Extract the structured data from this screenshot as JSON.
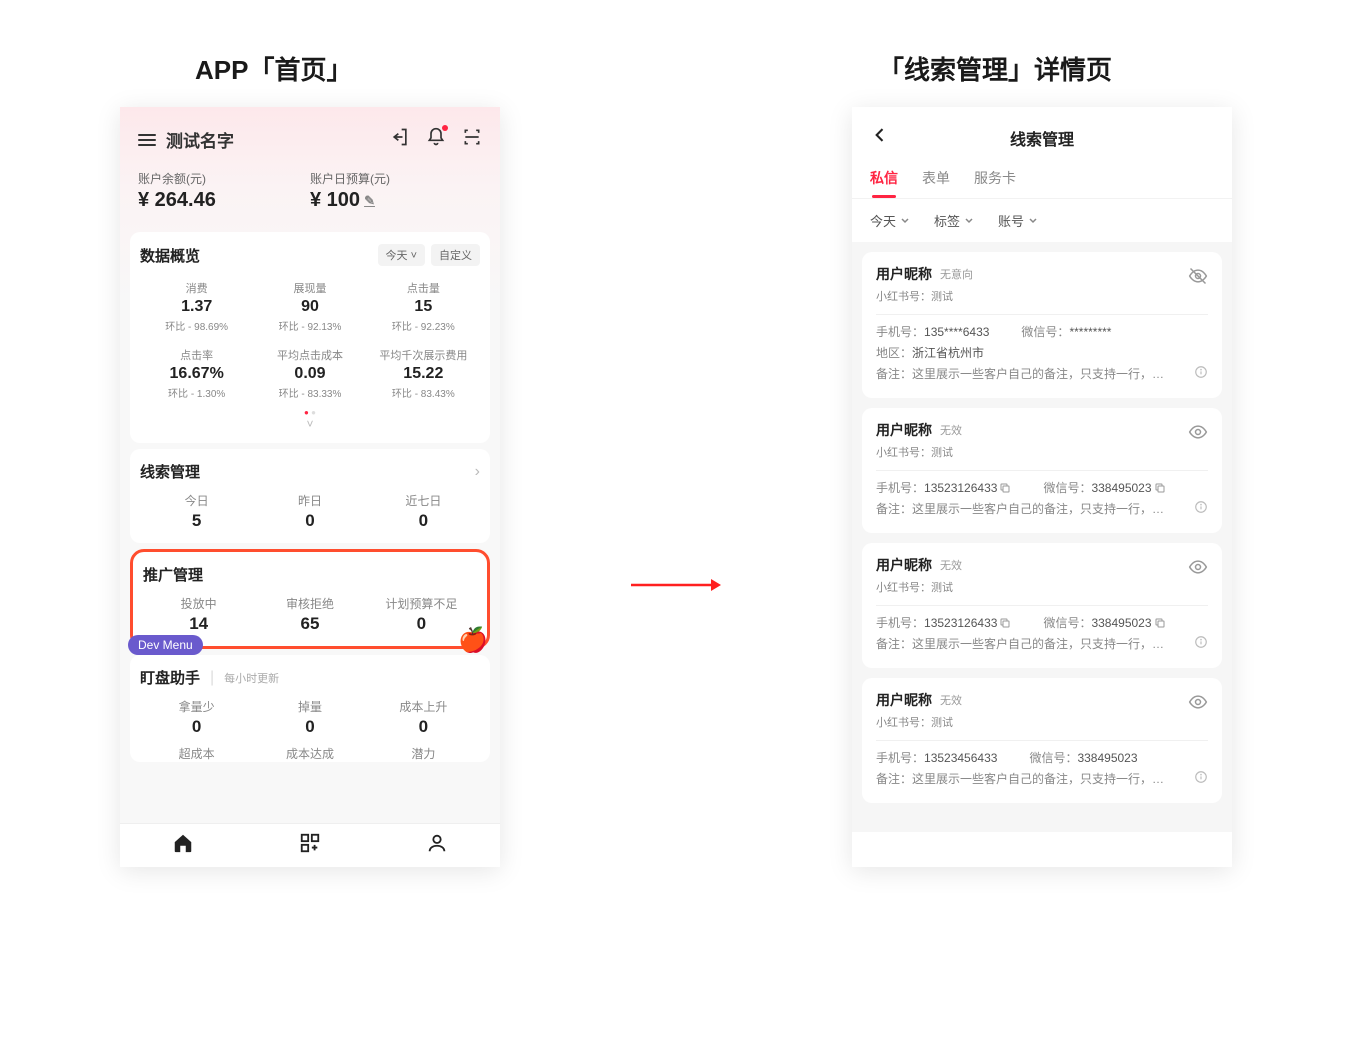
{
  "titles": {
    "left": "APP「首页」",
    "right": "「线索管理」详情页"
  },
  "home": {
    "name": "测试名字",
    "balance": {
      "label": "账户余额(元)",
      "value": "¥ 264.46"
    },
    "budget": {
      "label": "账户日预算(元)",
      "value": "¥ 100"
    },
    "overview": {
      "title": "数据概览",
      "chip_today": "今天",
      "chip_custom": "自定义",
      "metrics": [
        {
          "label": "消费",
          "value": "1.37",
          "delta_prefix": "环比",
          "delta": "- 98.69%"
        },
        {
          "label": "展现量",
          "value": "90",
          "delta_prefix": "环比",
          "delta": "- 92.13%"
        },
        {
          "label": "点击量",
          "value": "15",
          "delta_prefix": "环比",
          "delta": "- 92.23%"
        },
        {
          "label": "点击率",
          "value": "16.67%",
          "delta_prefix": "环比",
          "delta": "- 1.30%"
        },
        {
          "label": "平均点击成本",
          "value": "0.09",
          "delta_prefix": "环比",
          "delta": "- 83.33%"
        },
        {
          "label": "平均千次展示费用",
          "value": "15.22",
          "delta_prefix": "环比",
          "delta": "- 83.43%"
        }
      ]
    },
    "leads": {
      "title": "线索管理",
      "items": [
        {
          "label": "今日",
          "value": "5"
        },
        {
          "label": "昨日",
          "value": "0"
        },
        {
          "label": "近七日",
          "value": "0"
        }
      ]
    },
    "promo": {
      "title": "推广管理",
      "items": [
        {
          "label": "投放中",
          "value": "14"
        },
        {
          "label": "审核拒绝",
          "value": "65"
        },
        {
          "label": "计划预算不足",
          "value": "0"
        }
      ]
    },
    "dev_menu": "Dev Menu",
    "monitor": {
      "title": "盯盘助手",
      "hint": "每小时更新",
      "row1": [
        {
          "label": "拿量少",
          "value": "0"
        },
        {
          "label": "掉量",
          "value": "0"
        },
        {
          "label": "成本上升",
          "value": "0"
        }
      ],
      "row2": [
        {
          "label": "超成本"
        },
        {
          "label": "成本达成"
        },
        {
          "label": "潜力"
        }
      ]
    }
  },
  "detail": {
    "title": "线索管理",
    "tabs": [
      "私信",
      "表单",
      "服务卡"
    ],
    "filters": [
      "今天",
      "标签",
      "账号"
    ],
    "leads": [
      {
        "name": "用户昵称",
        "tag": "无意向",
        "sub": "小红书号：测试",
        "phone_label": "手机号：",
        "phone": "135****6433",
        "wechat_label": "微信号：",
        "wechat": "*********",
        "region_label": "地区：",
        "region": "浙江省杭州市",
        "note_label": "备注：",
        "note": "这里展示一些客户自己的备注，只支持一行，超…",
        "eye_off": true,
        "has_region": true,
        "has_copy": false
      },
      {
        "name": "用户昵称",
        "tag": "无效",
        "sub": "小红书号：测试",
        "phone_label": "手机号：",
        "phone": "13523126433",
        "wechat_label": "微信号：",
        "wechat": "338495023",
        "note_label": "备注：",
        "note": "这里展示一些客户自己的备注，只支持一行，超…",
        "eye_off": false,
        "has_region": false,
        "has_copy": true
      },
      {
        "name": "用户昵称",
        "tag": "无效",
        "sub": "小红书号：测试",
        "phone_label": "手机号：",
        "phone": "13523126433",
        "wechat_label": "微信号：",
        "wechat": "338495023",
        "note_label": "备注：",
        "note": "这里展示一些客户自己的备注，只支持一行，超…",
        "eye_off": false,
        "has_region": false,
        "has_copy": true
      },
      {
        "name": "用户昵称",
        "tag": "无效",
        "sub": "小红书号：测试",
        "phone_label": "手机号：",
        "phone": "13523456433",
        "wechat_label": "微信号：",
        "wechat": "338495023",
        "note_label": "备注：",
        "note": "这里展示一些客户自己的备注，只支持一行，超…",
        "eye_off": false,
        "has_region": false,
        "has_copy": false
      }
    ]
  }
}
